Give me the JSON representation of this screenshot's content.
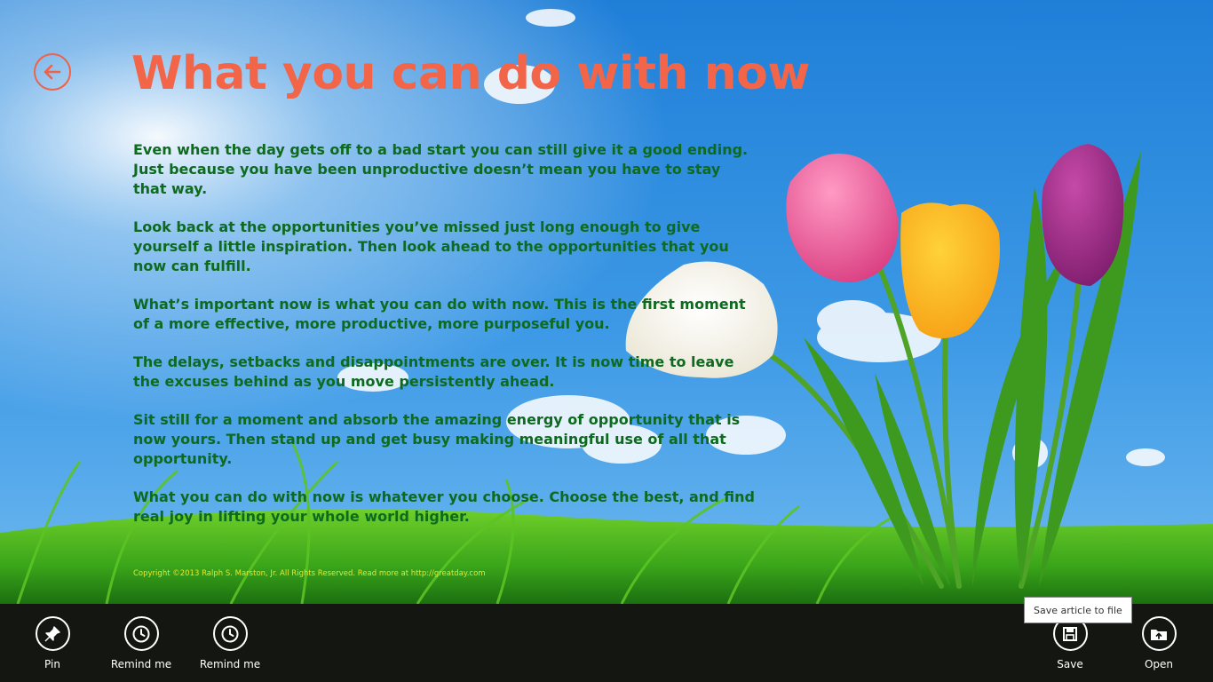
{
  "header": {
    "title": "What you can do with now",
    "back_icon": "arrow-left-icon"
  },
  "article": {
    "paragraphs": [
      "Even when the day gets off to a bad start you can still give it a good ending. Just because you have been unproductive doesn’t mean you have to stay that way.",
      "Look back at the opportunities you’ve missed just long enough to give yourself a little inspiration. Then look ahead to the opportunities that you now can fulfill.",
      "What’s important now is what you can do with now. This is the first moment of a more effective, more productive, more purposeful you.",
      "The delays, setbacks and disappointments are over. It is now time to leave the excuses behind as you move persistently ahead.",
      "Sit still for a moment and absorb the amazing energy of opportunity that is now yours. Then stand up and get busy making meaningful use of all that opportunity.",
      "What you can do with now is whatever you choose. Choose the best, and find real joy in lifting your whole world higher."
    ],
    "copyright": "Copyright ©2013 Ralph S. Marston, Jr. All Rights Reserved. Read more at http://greatday.com"
  },
  "appbar": {
    "left_buttons": [
      {
        "label": "Pin",
        "icon": "pin-icon"
      },
      {
        "label": "Remind me",
        "icon": "clock-icon"
      },
      {
        "label": "Remind me",
        "icon": "clock-icon"
      }
    ],
    "right_buttons": [
      {
        "label": "Save",
        "icon": "save-icon"
      },
      {
        "label": "Open",
        "icon": "open-icon"
      }
    ],
    "tooltip": "Save article to file"
  },
  "colors": {
    "title": "#f26549",
    "body_text": "#0d6a1f",
    "copyright": "#e8e62a",
    "appbar_bg": "#141711"
  }
}
